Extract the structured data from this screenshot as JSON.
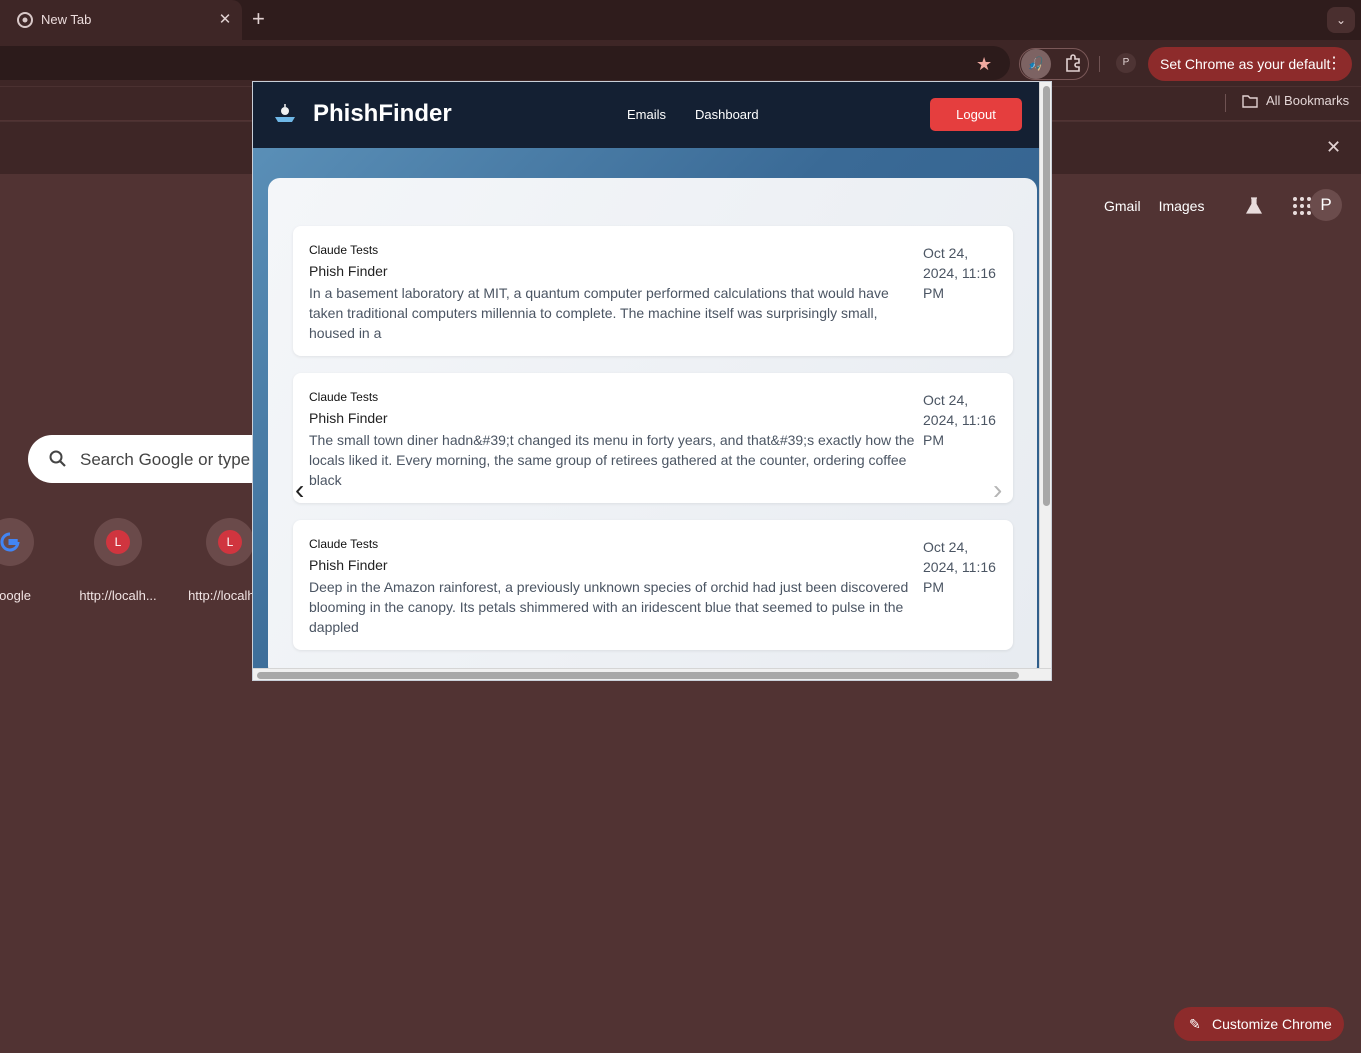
{
  "browser": {
    "tab_title": "New Tab",
    "tab_close": "✕",
    "new_tab": "+",
    "tab_search": "⌄",
    "profile_initial": "P",
    "set_default_label": "Set Chrome as your default",
    "menu_dots": "⋮",
    "all_bookmarks": "All Bookmarks",
    "infobar_close": "✕"
  },
  "ntp": {
    "gmail": "Gmail",
    "images": "Images",
    "avatar_initial": "P",
    "search_placeholder": "Search Google or type a URL",
    "shortcuts": [
      {
        "label": "Google",
        "icon": "google-icon"
      },
      {
        "label": "http://localh...",
        "letter": "L"
      },
      {
        "label": "http://localhost",
        "letter": "L"
      }
    ],
    "customize_label": "Customize Chrome"
  },
  "extension": {
    "brand": "PhishFinder",
    "nav": {
      "emails": "Emails",
      "dashboard": "Dashboard"
    },
    "logout": "Logout",
    "prev": "‹",
    "next": "›",
    "emails": [
      {
        "sender": "Claude Tests",
        "subject": "Phish Finder",
        "body": "In a basement laboratory at MIT, a quantum computer performed calculations that would have taken traditional computers millennia to complete. The machine itself was surprisingly small, housed in a",
        "date": "Oct 24, 2024, 11:16 PM"
      },
      {
        "sender": "Claude Tests",
        "subject": "Phish Finder",
        "body": "The small town diner hadn&#39;t changed its menu in forty years, and that&#39;s exactly how the locals liked it. Every morning, the same group of retirees gathered at the counter, ordering coffee black",
        "date": "Oct 24, 2024, 11:16 PM"
      },
      {
        "sender": "Claude Tests",
        "subject": "Phish Finder",
        "body": "Deep in the Amazon rainforest, a previously unknown species of orchid had just been discovered blooming in the canopy. Its petals shimmered with an iridescent blue that seemed to pulse in the dappled",
        "date": "Oct 24, 2024, 11:16 PM"
      }
    ]
  },
  "colors": {
    "chrome_bg": "#513333",
    "accent_red": "#e53e3e",
    "phishfinder_header": "#142033"
  }
}
